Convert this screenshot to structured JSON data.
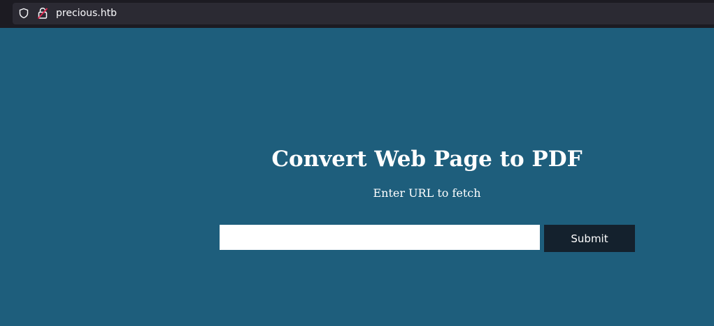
{
  "browser": {
    "url": "precious.htb",
    "icons": {
      "tracking": "shield-icon",
      "security": "insecure-lock-icon"
    }
  },
  "main": {
    "title": "Convert Web Page to PDF",
    "subtitle": "Enter URL to fetch",
    "url_input": {
      "value": "",
      "placeholder": ""
    },
    "submit_label": "Submit"
  },
  "colors": {
    "page_background": "#1e5e7c",
    "button_background": "#14212d",
    "browser_chrome": "#1c1b22",
    "url_bar": "#2b2a33"
  }
}
